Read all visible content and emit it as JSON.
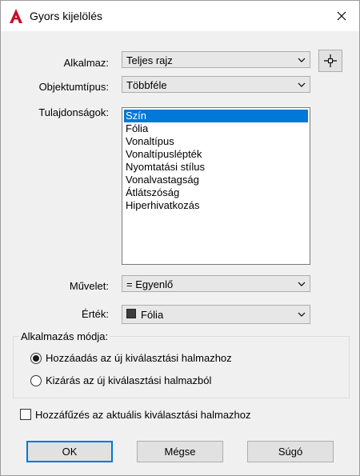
{
  "window": {
    "title": "Gyors kijelölés"
  },
  "fields": {
    "apply_label": "Alkalmaz:",
    "apply_value": "Teljes rajz",
    "object_type_label": "Objektumtípus:",
    "object_type_value": "Többféle",
    "properties_label": "Tulajdonságok:",
    "operation_label": "Művelet:",
    "operation_value": "= Egyenlő",
    "value_label": "Érték:",
    "value_value": "Fólia"
  },
  "properties": [
    "Szín",
    "Fólia",
    "Vonaltípus",
    "Vonaltípuslépték",
    "Nyomtatási stílus",
    "Vonalvastagság",
    "Átlátszóság",
    "Hiperhivatkozás"
  ],
  "apply_mode": {
    "title": "Alkalmazás módja:",
    "include_label": "Hozzáadás az új kiválasztási halmazhoz",
    "exclude_label": "Kizárás az új kiválasztási halmazból"
  },
  "append_label": "Hozzáfűzés az aktuális kiválasztási halmazhoz",
  "buttons": {
    "ok": "OK",
    "cancel": "Mégse",
    "help": "Súgó"
  },
  "colors": {
    "accent": "#0078d7",
    "brand": "#c8102e"
  }
}
